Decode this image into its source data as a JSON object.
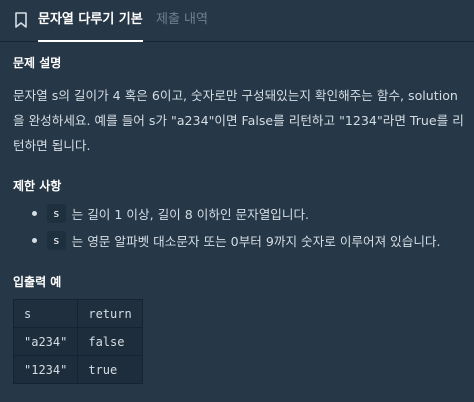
{
  "tabs": {
    "bookmark_icon": "bookmark-icon",
    "active_label": "문자열 다루기 기본",
    "inactive_label": "제출 내역"
  },
  "problem": {
    "title": "문제 설명",
    "description": "문자열 s의 길이가 4 혹은 6이고, 숫자로만 구성돼있는지 확인해주는 함수, solution을 완성하세요. 예를 들어 s가 \"a234\"이면 False를 리턴하고 \"1234\"라면 True를 리턴하면 됩니다."
  },
  "constraints": {
    "title": "제한 사항",
    "items": [
      {
        "code": "s",
        "text": "는 길이 1 이상, 길이 8 이하인 문자열입니다."
      },
      {
        "code": "s",
        "text": "는 영문 알파벳 대소문자 또는 0부터 9까지 숫자로 이루어져 있습니다."
      }
    ]
  },
  "examples": {
    "title": "입출력 예",
    "headers": [
      "s",
      "return"
    ],
    "rows": [
      [
        "\"a234\"",
        "false"
      ],
      [
        "\"1234\"",
        "true"
      ]
    ]
  }
}
